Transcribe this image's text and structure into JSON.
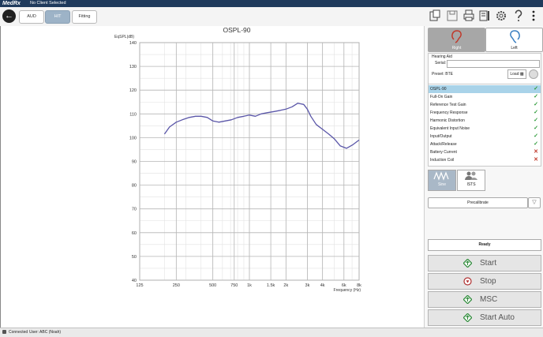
{
  "app": {
    "logo": "MedRx",
    "client": "No Client Selected"
  },
  "toolbar": {
    "tabs": [
      {
        "label": "AUD"
      },
      {
        "label": "HIT"
      },
      {
        "label": "Fitting"
      }
    ],
    "active_tab": "HIT"
  },
  "chart": {
    "title": "OSPL-90",
    "ylabel": "EqSPL(dB)",
    "xlabel": "Frequency (Hz)",
    "yticks": [
      "140",
      "130",
      "120",
      "110",
      "100",
      "90",
      "80",
      "70",
      "60",
      "50",
      "40"
    ],
    "xticks": [
      "125",
      "250",
      "500",
      "750",
      "1k",
      "1.5k",
      "2k",
      "3k",
      "4k",
      "6k",
      "8k"
    ]
  },
  "chart_data": {
    "type": "line",
    "title": "OSPL-90",
    "xlabel": "Frequency (Hz)",
    "ylabel": "EqSPL(dB)",
    "xscale": "log",
    "xlim": [
      125,
      8000
    ],
    "ylim": [
      40,
      140
    ],
    "grid": true,
    "series": [
      {
        "color": "#5a56a8",
        "x": [
          200,
          220,
          250,
          280,
          320,
          360,
          400,
          450,
          500,
          560,
          630,
          710,
          800,
          900,
          1000,
          1120,
          1250,
          1400,
          1600,
          1800,
          2000,
          2250,
          2500,
          2800,
          3000,
          3200,
          3550,
          4000,
          4500,
          5000,
          5600,
          6300,
          7100,
          8000
        ],
        "y": [
          101.5,
          104.5,
          106.5,
          107.5,
          108.5,
          109,
          109,
          108.5,
          107,
          106.5,
          107,
          107.5,
          108.5,
          109,
          109.5,
          109,
          110,
          110.5,
          111,
          111.5,
          112,
          113,
          114.5,
          114,
          112,
          109,
          105.5,
          103.5,
          101.5,
          99.5,
          96.5,
          95.5,
          97,
          99
        ]
      }
    ]
  },
  "ear": {
    "right_label": "Right",
    "left_label": "Left"
  },
  "hearing_aid": {
    "title": "Hearing Aid",
    "serial_label": "Serial:",
    "serial_value": "",
    "preset_label": "Preset:",
    "preset_value": "BTE",
    "load_label": "Load"
  },
  "tests": [
    {
      "name": "OSPL-90",
      "status": "pass"
    },
    {
      "name": "Full-On Gain",
      "status": "pass"
    },
    {
      "name": "Reference Test Gain",
      "status": "pass"
    },
    {
      "name": "Frequency Response",
      "status": "pass"
    },
    {
      "name": "Harmonic Distortion",
      "status": "pass"
    },
    {
      "name": "Equivalent Input Noise",
      "status": "pass"
    },
    {
      "name": "Input/Output",
      "status": "pass"
    },
    {
      "name": "Attack/Release",
      "status": "pass"
    },
    {
      "name": "Battery Current",
      "status": "fail"
    },
    {
      "name": "Induction Coil",
      "status": "fail"
    }
  ],
  "stimulus": {
    "sweep_label": "Sine",
    "ists_label": "ISTS"
  },
  "precalibrate_label": "Precalibrate",
  "status_text": "Ready",
  "actions": {
    "start": "Start",
    "stop": "Stop",
    "msc": "MSC",
    "start_auto": "Start Auto"
  },
  "statusbar": {
    "connection": "Connected",
    "user": "User: ABC (Noah)"
  },
  "colors": {
    "pass": "#2e9b3a",
    "fail": "#c0392b",
    "curve": "#5a56a8",
    "titlebar": "#1f3a5c",
    "selected_row": "#a9d3e9"
  }
}
